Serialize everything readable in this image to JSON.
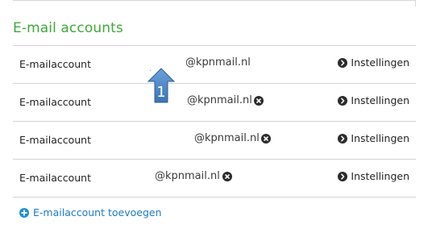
{
  "section": {
    "title": "E-mail accounts"
  },
  "accounts": [
    {
      "label": "E-mailaccount",
      "email": "@kpnmail.nl",
      "removable": false,
      "settings_label": "Instellingen"
    },
    {
      "label": "E-mailaccount",
      "email": "@kpnmail.nl",
      "removable": true,
      "settings_label": "Instellingen"
    },
    {
      "label": "E-mailaccount",
      "email": "@kpnmail.nl",
      "removable": true,
      "settings_label": "Instellingen"
    },
    {
      "label": "E-mailaccount",
      "email": "@kpnmail.nl",
      "removable": true,
      "settings_label": "Instellingen"
    }
  ],
  "callout": {
    "number": "1",
    "color": "#4a86c5"
  },
  "add_account": {
    "label": "E-mailaccount toevoegen",
    "icon": "plus-circle-icon"
  },
  "icons": {
    "settings": "chevron-right-circle-icon",
    "remove": "close-circle-icon"
  },
  "colors": {
    "title": "#3ea83a",
    "link": "#1b7ac7",
    "icon_dark": "#2b2b2b"
  }
}
